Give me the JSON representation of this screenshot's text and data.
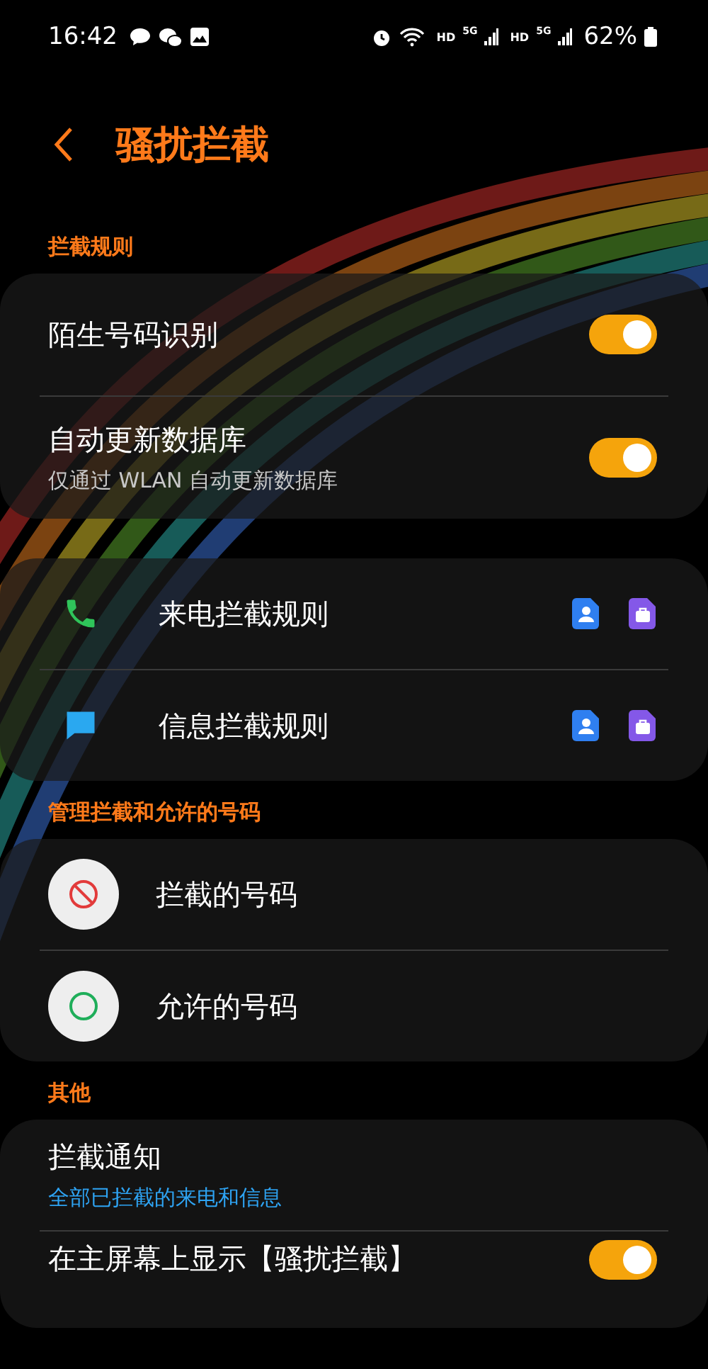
{
  "status_bar": {
    "time": "16:42",
    "network_labels": [
      "HD",
      "5G",
      "HD",
      "5G"
    ],
    "battery": "62%"
  },
  "header": {
    "title": "骚扰拦截"
  },
  "sections": [
    {
      "label": "拦截规则",
      "rows": [
        {
          "kind": "toggle",
          "title": "陌生号码识别",
          "on": true
        },
        {
          "kind": "toggle",
          "title": "自动更新数据库",
          "subtitle": "仅通过 WLAN 自动更新数据库",
          "on": true
        }
      ]
    },
    {
      "rows": [
        {
          "kind": "call",
          "title": "来电拦截规则"
        },
        {
          "kind": "message",
          "title": "信息拦截规则"
        }
      ]
    },
    {
      "label": "管理拦截和允许的号码",
      "rows": [
        {
          "kind": "blocked",
          "title": "拦截的号码"
        },
        {
          "kind": "allowed",
          "title": "允许的号码"
        }
      ]
    },
    {
      "label": "其他",
      "rows": [
        {
          "kind": "summary",
          "title": "拦截通知",
          "subtitle": "全部已拦截的来电和信息"
        },
        {
          "kind": "toggle",
          "title": "在主屏幕上显示【骚扰拦截】",
          "on": true
        }
      ]
    }
  ]
}
